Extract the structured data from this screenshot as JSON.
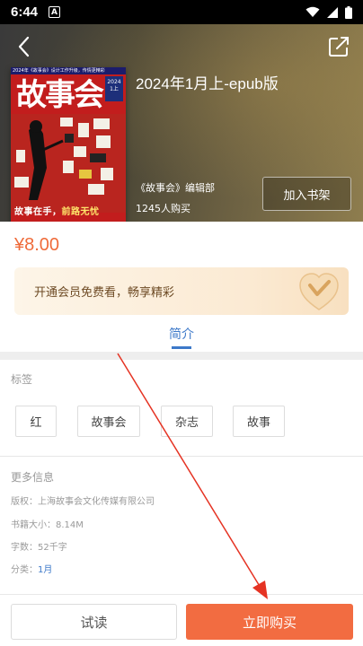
{
  "status_bar": {
    "time": "6:44",
    "notification_letter": "A"
  },
  "book": {
    "title": "2024年1月上-epub版",
    "author": "《故事会》编辑部",
    "buyers": "1245人购买",
    "add_to_shelf_label": "加入书架",
    "price": "¥8.00",
    "cover": {
      "masthead": "故事会",
      "top_line": "2024年《故事会》设计工作升级，传情更精彩",
      "badge": "2024 1上",
      "bottom_text_main": "故事在手，",
      "bottom_text_accent": "前路无忧",
      "brand_color": "#c21d1d"
    }
  },
  "vip_banner": {
    "text": "开通会员免费看，畅享精彩",
    "icon": "vip-heart-check-icon"
  },
  "tabs": {
    "intro": "简介"
  },
  "tags": {
    "label": "标签",
    "items": [
      "红",
      "故事会",
      "杂志",
      "故事"
    ]
  },
  "more_info": {
    "label": "更多信息",
    "copyright": "版权：上海故事会文化传媒有限公司",
    "size": "书籍大小：8.14M",
    "word_count": "字数：52千字",
    "category_prefix": "分类：",
    "category_value": "1月"
  },
  "actions": {
    "try_read": "试读",
    "buy_now": "立即购买"
  },
  "colors": {
    "accent": "#f26c41",
    "link": "#3d79c9",
    "price": "#ef6b3a",
    "annotation_arrow": "#e53323"
  }
}
